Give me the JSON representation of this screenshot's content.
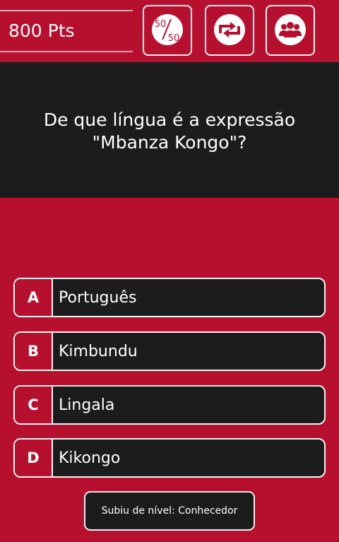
{
  "header": {
    "points": "800 Pts",
    "fifty_fifty": {
      "top": "50",
      "bottom": "50"
    },
    "icons": [
      "fifty-fifty-icon",
      "swap-question-icon",
      "audience-help-icon"
    ]
  },
  "question": {
    "line1": "De que língua é a expressão",
    "line2": "\"Mbanza Kongo\"?"
  },
  "answers": [
    {
      "letter": "A",
      "text": "Português"
    },
    {
      "letter": "B",
      "text": "Kimbundu"
    },
    {
      "letter": "C",
      "text": "Lingala"
    },
    {
      "letter": "D",
      "text": "Kikongo"
    }
  ],
  "toast": {
    "text": "Subiu de nível: Conhecedor"
  },
  "colors": {
    "brand_red": "#b7102f",
    "panel_dark": "#1c1c1c",
    "border_light": "#f2f2f2"
  }
}
